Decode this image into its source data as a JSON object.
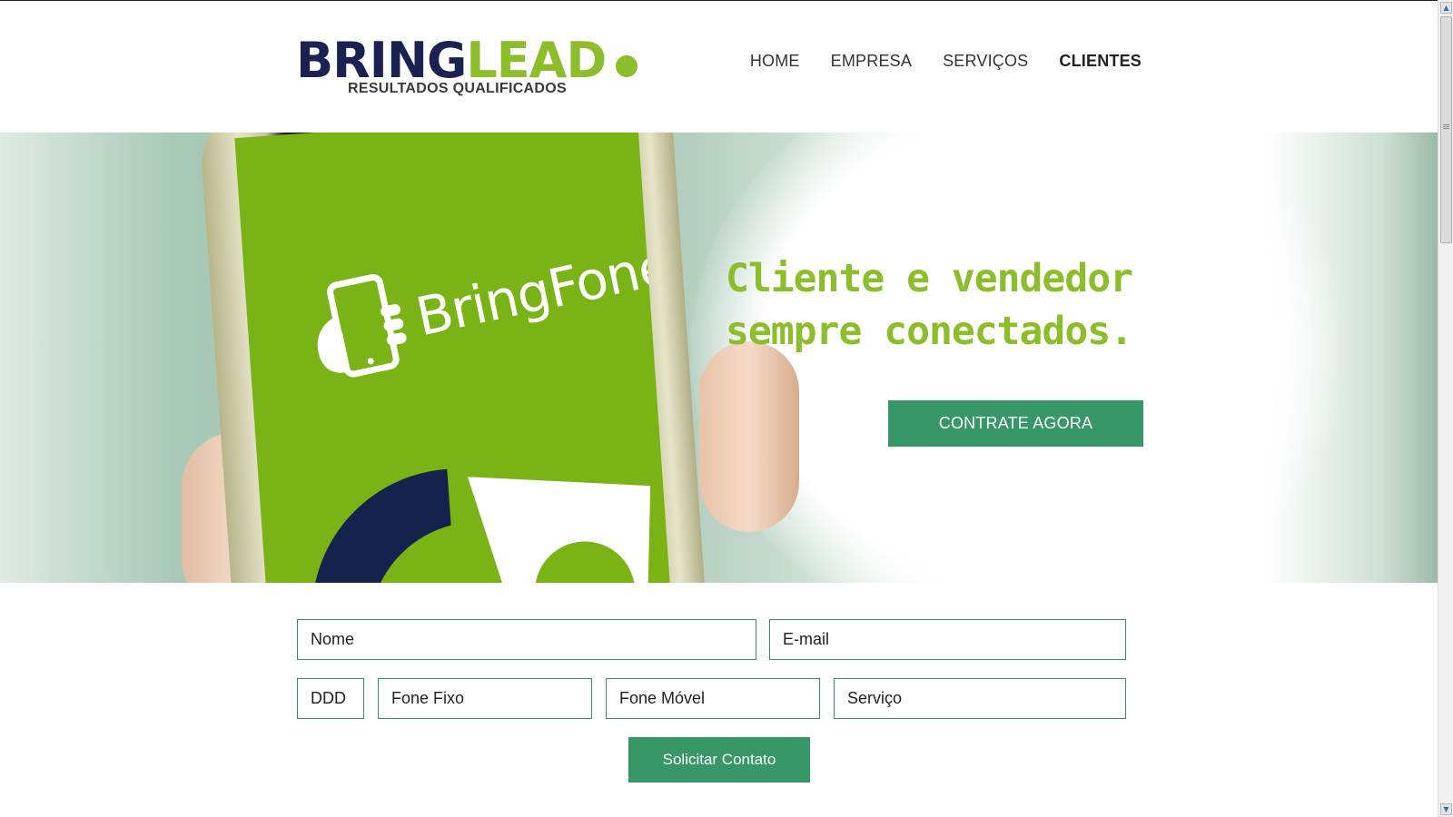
{
  "header": {
    "logo": {
      "part1": "BRING",
      "part2": "LEAD",
      "tagline": "RESULTADOS QUALIFICADOS"
    },
    "nav": [
      {
        "label": "HOME"
      },
      {
        "label": "EMPRESA"
      },
      {
        "label": "SERVIÇOS"
      },
      {
        "label": "CLIENTES"
      }
    ]
  },
  "hero": {
    "phone_brand": "BringFone",
    "headline_line1": "Cliente e vendedor",
    "headline_line2": "sempre conectados.",
    "cta_label": "CONTRATE AGORA"
  },
  "form": {
    "name_placeholder": "Nome",
    "email_placeholder": "E-mail",
    "ddd_placeholder": "DDD",
    "phone_fixed_placeholder": "Fone Fixo",
    "phone_mobile_placeholder": "Fone Móvel",
    "service_placeholder": "Serviço",
    "submit_label": "Solicitar Contato"
  },
  "colors": {
    "brand_navy": "#1b2150",
    "brand_green": "#8cbd2a",
    "button_green": "#379767"
  }
}
